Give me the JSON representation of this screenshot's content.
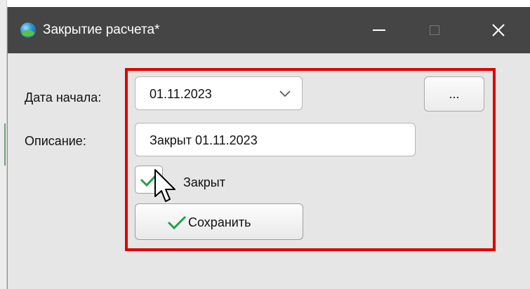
{
  "window": {
    "title": "Закрытие расчета*",
    "app_icon": "globe-icon",
    "controls": {
      "minimize": "minimize-icon",
      "maximize": "maximize-icon",
      "close": "close-icon",
      "close_glyph": "✕"
    }
  },
  "form": {
    "start_date": {
      "label": "Дата начала:",
      "value": "01.11.2023",
      "dropdown_icon": "chevron-down-icon"
    },
    "picker_button": {
      "label": "..."
    },
    "description": {
      "label": "Описание:",
      "value": "Закрыт 01.11.2023"
    },
    "closed_checkbox": {
      "label": "Закрыт",
      "checked": true,
      "check_icon": "checkmark-icon"
    },
    "save_button": {
      "label": "Сохранить",
      "icon": "checkmark-icon"
    }
  },
  "colors": {
    "titlebar": "#454545",
    "window_bg": "#e6e6e6",
    "highlight": "#e00000",
    "check_green": "#22a14a"
  },
  "annotation": {
    "highlight_box": "red-rectangle"
  },
  "pointer": "arrow-cursor"
}
